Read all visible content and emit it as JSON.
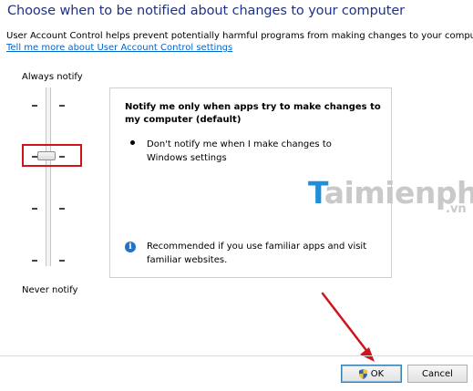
{
  "header": {
    "title": "Choose when to be notified about changes to your computer",
    "description": "User Account Control helps prevent potentially harmful programs from making changes to your computer.",
    "link": "Tell me more about User Account Control settings"
  },
  "slider": {
    "top_label": "Always notify",
    "bottom_label": "Never notify",
    "level_count": 4,
    "selected_level": 2
  },
  "panel": {
    "heading": "Notify me only when apps try to make changes to my computer (default)",
    "bullet": "Don't notify me when I make changes to Windows settings",
    "info": "Recommended if you use familiar apps and visit familiar websites.",
    "info_icon": "info-icon"
  },
  "watermark": {
    "logo_t": "T",
    "logo_rest": "aimienphi",
    "logo_suffix": ".vn"
  },
  "buttons": {
    "ok": "OK",
    "cancel": "Cancel"
  },
  "colors": {
    "title": "#1e3287",
    "link": "#0066cc",
    "highlight": "#d0141b",
    "info": "#1e73c8"
  }
}
